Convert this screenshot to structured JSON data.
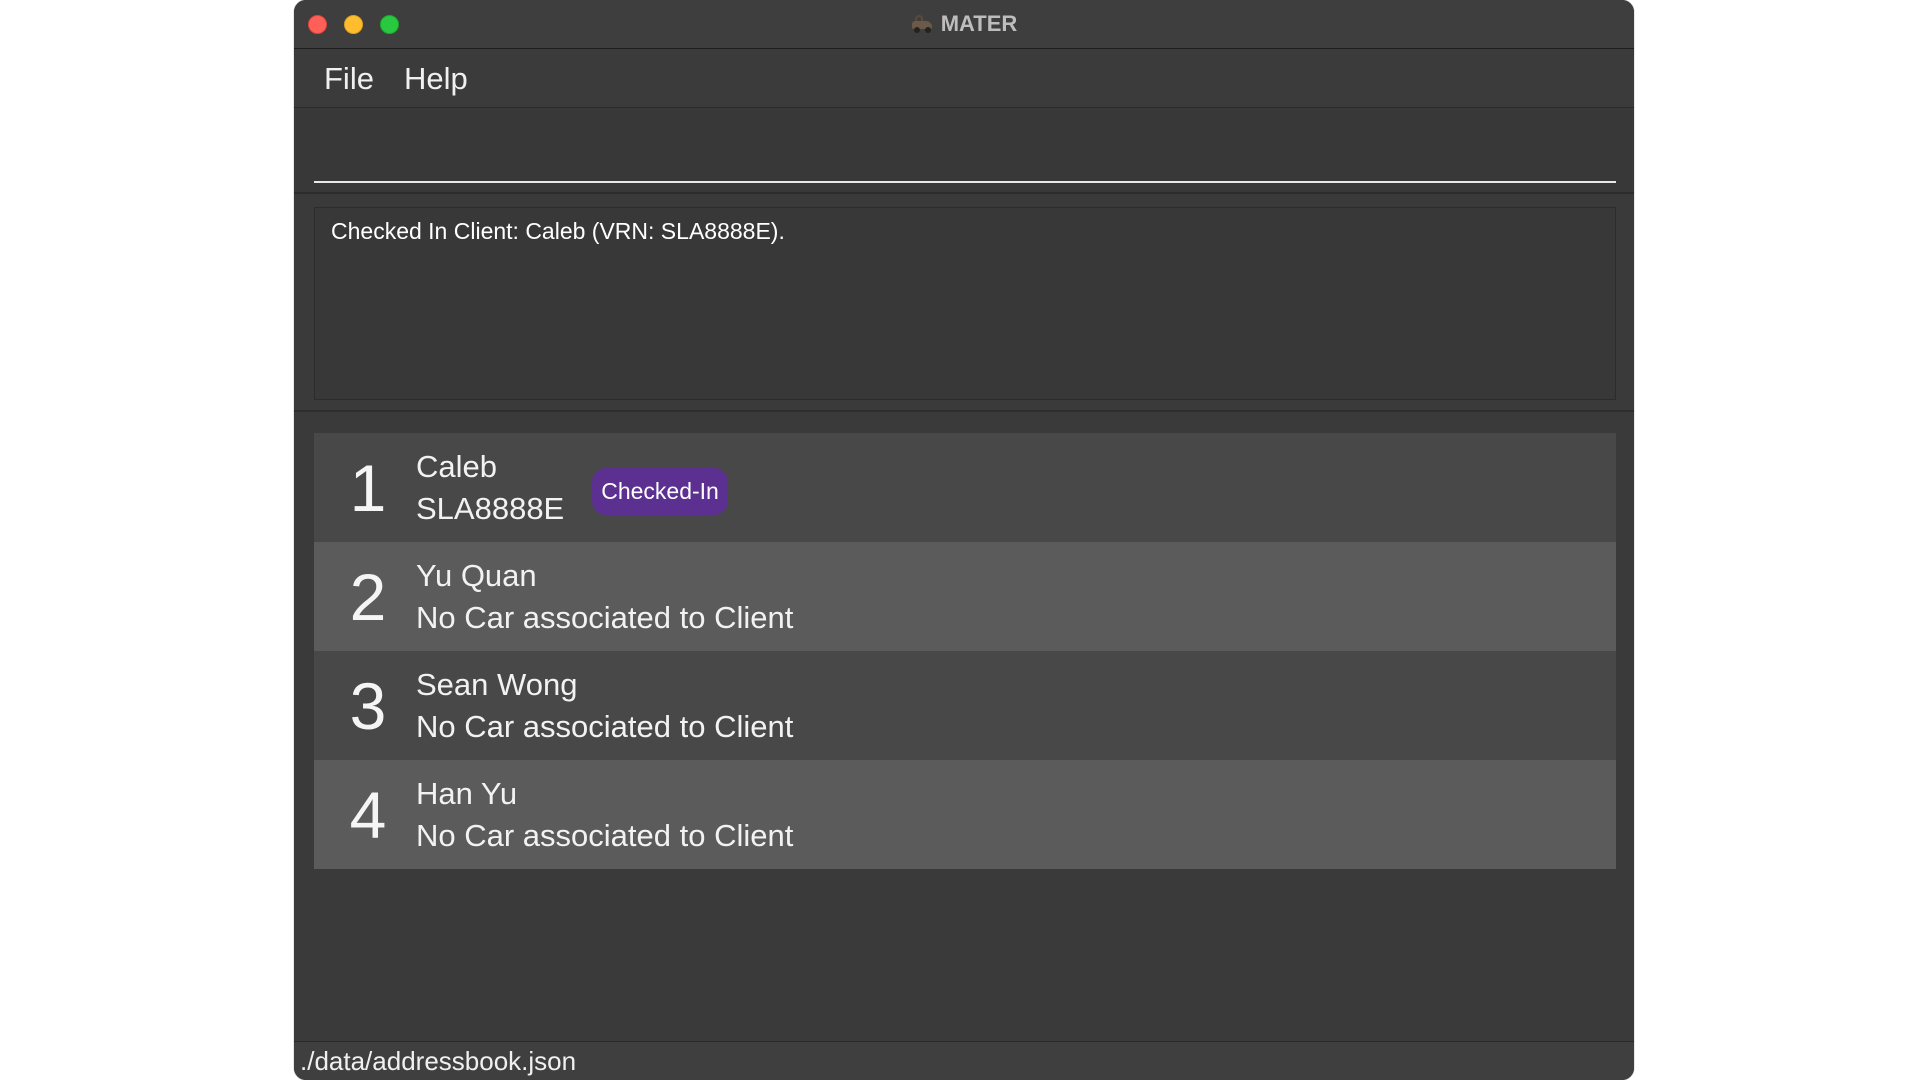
{
  "window": {
    "title": "MATER",
    "app_icon": "tow-truck-icon"
  },
  "menu": {
    "items": [
      {
        "label": "File"
      },
      {
        "label": "Help"
      }
    ]
  },
  "command": {
    "value": "",
    "placeholder": ""
  },
  "result": {
    "message": "Checked In Client: Caleb (VRN: SLA8888E)."
  },
  "clients": [
    {
      "index": "1",
      "name": "Caleb",
      "car": "SLA8888E",
      "badge": "Checked-In"
    },
    {
      "index": "2",
      "name": "Yu Quan",
      "car": "No Car associated to Client"
    },
    {
      "index": "3",
      "name": "Sean Wong",
      "car": "No Car associated to Client"
    },
    {
      "index": "4",
      "name": "Han Yu",
      "car": "No Car associated to Client"
    }
  ],
  "status": {
    "file_path": "./data/addressbook.json"
  },
  "colors": {
    "badge_background": "#5b3090",
    "window_background": "#3a3a3a",
    "row_odd": "#484848",
    "row_even": "#5b5b5b"
  }
}
